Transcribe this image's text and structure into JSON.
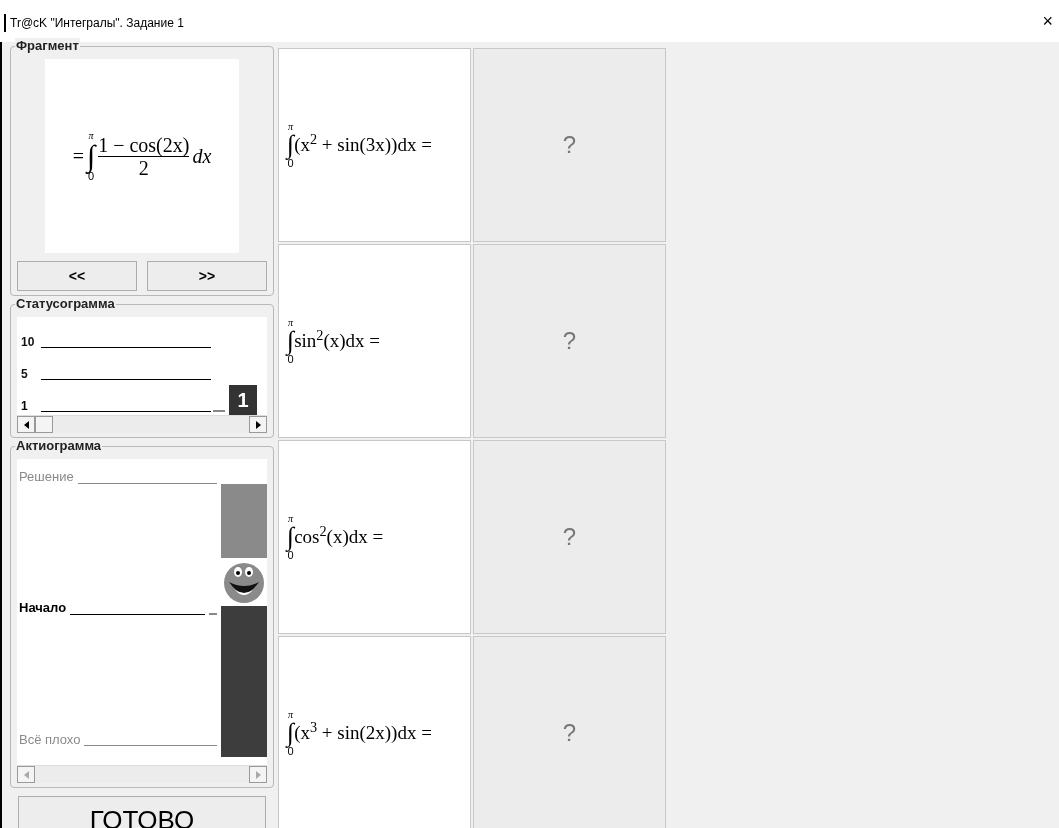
{
  "window": {
    "title": "Tr@cK \"Интегралы\". Задание 1",
    "close": "×"
  },
  "fragment": {
    "title": "Фрагмент",
    "formula": {
      "prefix": "=",
      "sign": "∫",
      "upper": "π",
      "lower": "0",
      "numerator": "1 − cos(2x)",
      "denominator": "2",
      "suffix": "dx"
    },
    "buttons": [
      "<<",
      ">>"
    ]
  },
  "statusogram": {
    "title": "Статусограмма",
    "levels": [
      {
        "label": "10",
        "selected": false
      },
      {
        "label": "5",
        "selected": false
      },
      {
        "label": "1",
        "selected": true
      }
    ],
    "marker": "1"
  },
  "actiogram": {
    "title": "Актиограмма",
    "levels": [
      {
        "label": "Решение",
        "selected": false
      },
      {
        "label": "Начало",
        "selected": true
      },
      {
        "label": "Всё плохо",
        "selected": false
      }
    ]
  },
  "done_button": "ГОТОВО",
  "tasks": [
    {
      "sign": "∫",
      "upper": "π",
      "lower": "0",
      "integrand": "(x$^{2}$ + sin(3x))dx =",
      "answer": "?"
    },
    {
      "sign": "∫",
      "upper": "π",
      "lower": "0",
      "integrand": "sin$^{2}$(x)dx =",
      "answer": "?"
    },
    {
      "sign": "∫",
      "upper": "π",
      "lower": "0",
      "integrand": "cos$^{2}$(x)dx =",
      "answer": "?"
    },
    {
      "sign": "∫",
      "upper": "π",
      "lower": "0",
      "integrand": "(x$^{3}$ + sin(2x))dx =",
      "answer": "?"
    }
  ]
}
